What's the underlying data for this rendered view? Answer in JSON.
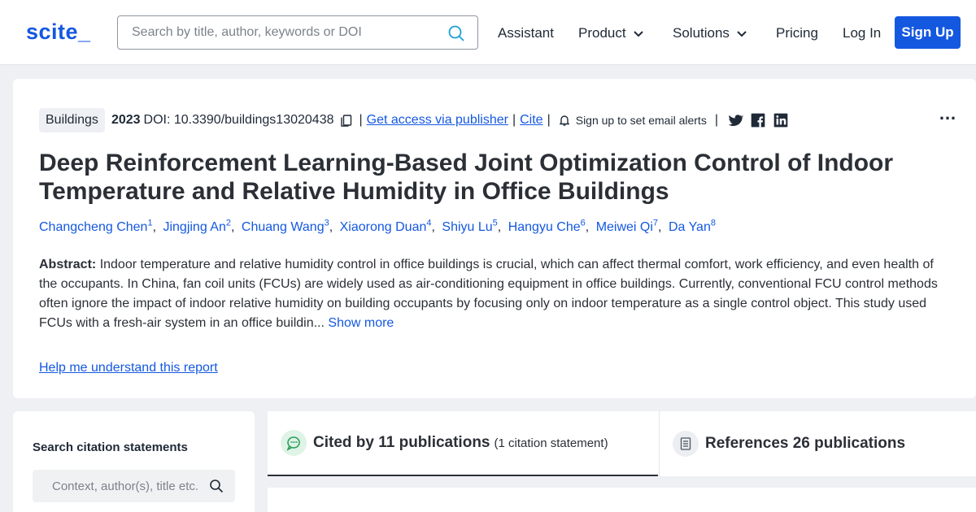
{
  "header": {
    "logo": "scite_",
    "search_placeholder": "Search by title, author, keywords or DOI",
    "nav": {
      "assistant": "Assistant",
      "product": "Product",
      "solutions": "Solutions",
      "pricing": "Pricing",
      "login": "Log In",
      "signup": "Sign Up"
    }
  },
  "paper": {
    "tag": "Buildings",
    "year": "2023",
    "doi": "DOI: 10.3390/buildings13020438",
    "access_link": "Get access via publisher",
    "cite_link": "Cite",
    "alerts": "Sign up to set email alerts",
    "title": "Deep Reinforcement Learning-Based Joint Optimization Control of Indoor Temperature and Relative Humidity in Office Buildings",
    "authors": [
      {
        "name": "Changcheng Chen",
        "sup": "1"
      },
      {
        "name": "Jingjing An",
        "sup": "2"
      },
      {
        "name": "Chuang Wang",
        "sup": "3"
      },
      {
        "name": "Xiaorong Duan",
        "sup": "4"
      },
      {
        "name": "Shiyu Lu",
        "sup": "5"
      },
      {
        "name": "Hangyu Che",
        "sup": "6"
      },
      {
        "name": "Meiwei Qi",
        "sup": "7"
      },
      {
        "name": "Da Yan",
        "sup": "8"
      }
    ],
    "abstract_label": "Abstract:",
    "abstract_text": "Indoor temperature and relative humidity control in office buildings is crucial, which can affect thermal comfort, work efficiency, and even health of the occupants. In China, fan coil units (FCUs) are widely used as air-conditioning equipment in office buildings. Currently, conventional FCU control methods often ignore the impact of indoor relative humidity on building occupants by focusing only on indoor temperature as a single control object. This study used FCUs with a fresh-air system in an office buildin...",
    "show_more": "Show more",
    "help_link": "Help me understand this report"
  },
  "citation_search": {
    "title": "Search citation statements",
    "placeholder": "Context, author(s), title etc."
  },
  "tabs": {
    "cited_main": "Cited by 11 publications",
    "cited_sub": "(1 citation statement)",
    "refs_main": "References 26 publications"
  },
  "colors": {
    "brand": "#1458e0",
    "cited_icon": "#2e9e5b"
  },
  "icons": {
    "copy": "copy-icon",
    "bell": "bell-icon",
    "twitter": "twitter-icon",
    "facebook": "facebook-icon",
    "linkedin": "linkedin-icon",
    "search": "search-icon",
    "more": "more-options-icon",
    "cited": "chat-bubble-icon",
    "references": "document-icon"
  }
}
